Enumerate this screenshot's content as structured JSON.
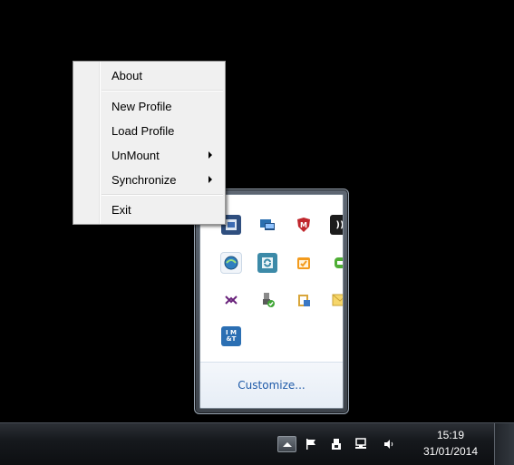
{
  "context_menu": {
    "items": [
      {
        "label": "About",
        "submenu": false
      },
      {
        "label": "New Profile",
        "submenu": false
      },
      {
        "label": "Load Profile",
        "submenu": false
      },
      {
        "label": "UnMount",
        "submenu": true
      },
      {
        "label": "Synchronize",
        "submenu": true
      },
      {
        "label": "Exit",
        "submenu": false
      }
    ]
  },
  "tray_overflow": {
    "customize_label": "Customize...",
    "icons": [
      {
        "name": "admin-tools-icon",
        "glyph": "",
        "color": "#2f4f7f"
      },
      {
        "name": "network-monitor-icon",
        "glyph": "",
        "color": "#2a6fb0"
      },
      {
        "name": "mcafee-icon",
        "glyph": "M",
        "color": "#c0262c"
      },
      {
        "name": "wireless-icon",
        "glyph": "))",
        "color": "#222222"
      },
      {
        "name": "app-globe-icon",
        "glyph": "",
        "color": "#2f7fbf"
      },
      {
        "name": "sync-icon",
        "glyph": "S",
        "color": "#3c8aa8"
      },
      {
        "name": "task-check-icon",
        "glyph": "✓",
        "color": "#f39b1d"
      },
      {
        "name": "green-app-icon",
        "glyph": "",
        "color": "#4fae35"
      },
      {
        "name": "visual-studio-icon",
        "glyph": "⋈",
        "color": "#68217a"
      },
      {
        "name": "usb-safe-remove-icon",
        "glyph": "",
        "color": "#6f6f6f"
      },
      {
        "name": "clipboard-icon",
        "glyph": "",
        "color": "#d9a63b"
      },
      {
        "name": "mail-icon",
        "glyph": "✉",
        "color": "#e8c24a"
      },
      {
        "name": "imat-icon",
        "glyph": "I M &T",
        "color": "#2b6fb3"
      }
    ]
  },
  "taskbar": {
    "time": "15:19",
    "date": "31/01/2014"
  }
}
